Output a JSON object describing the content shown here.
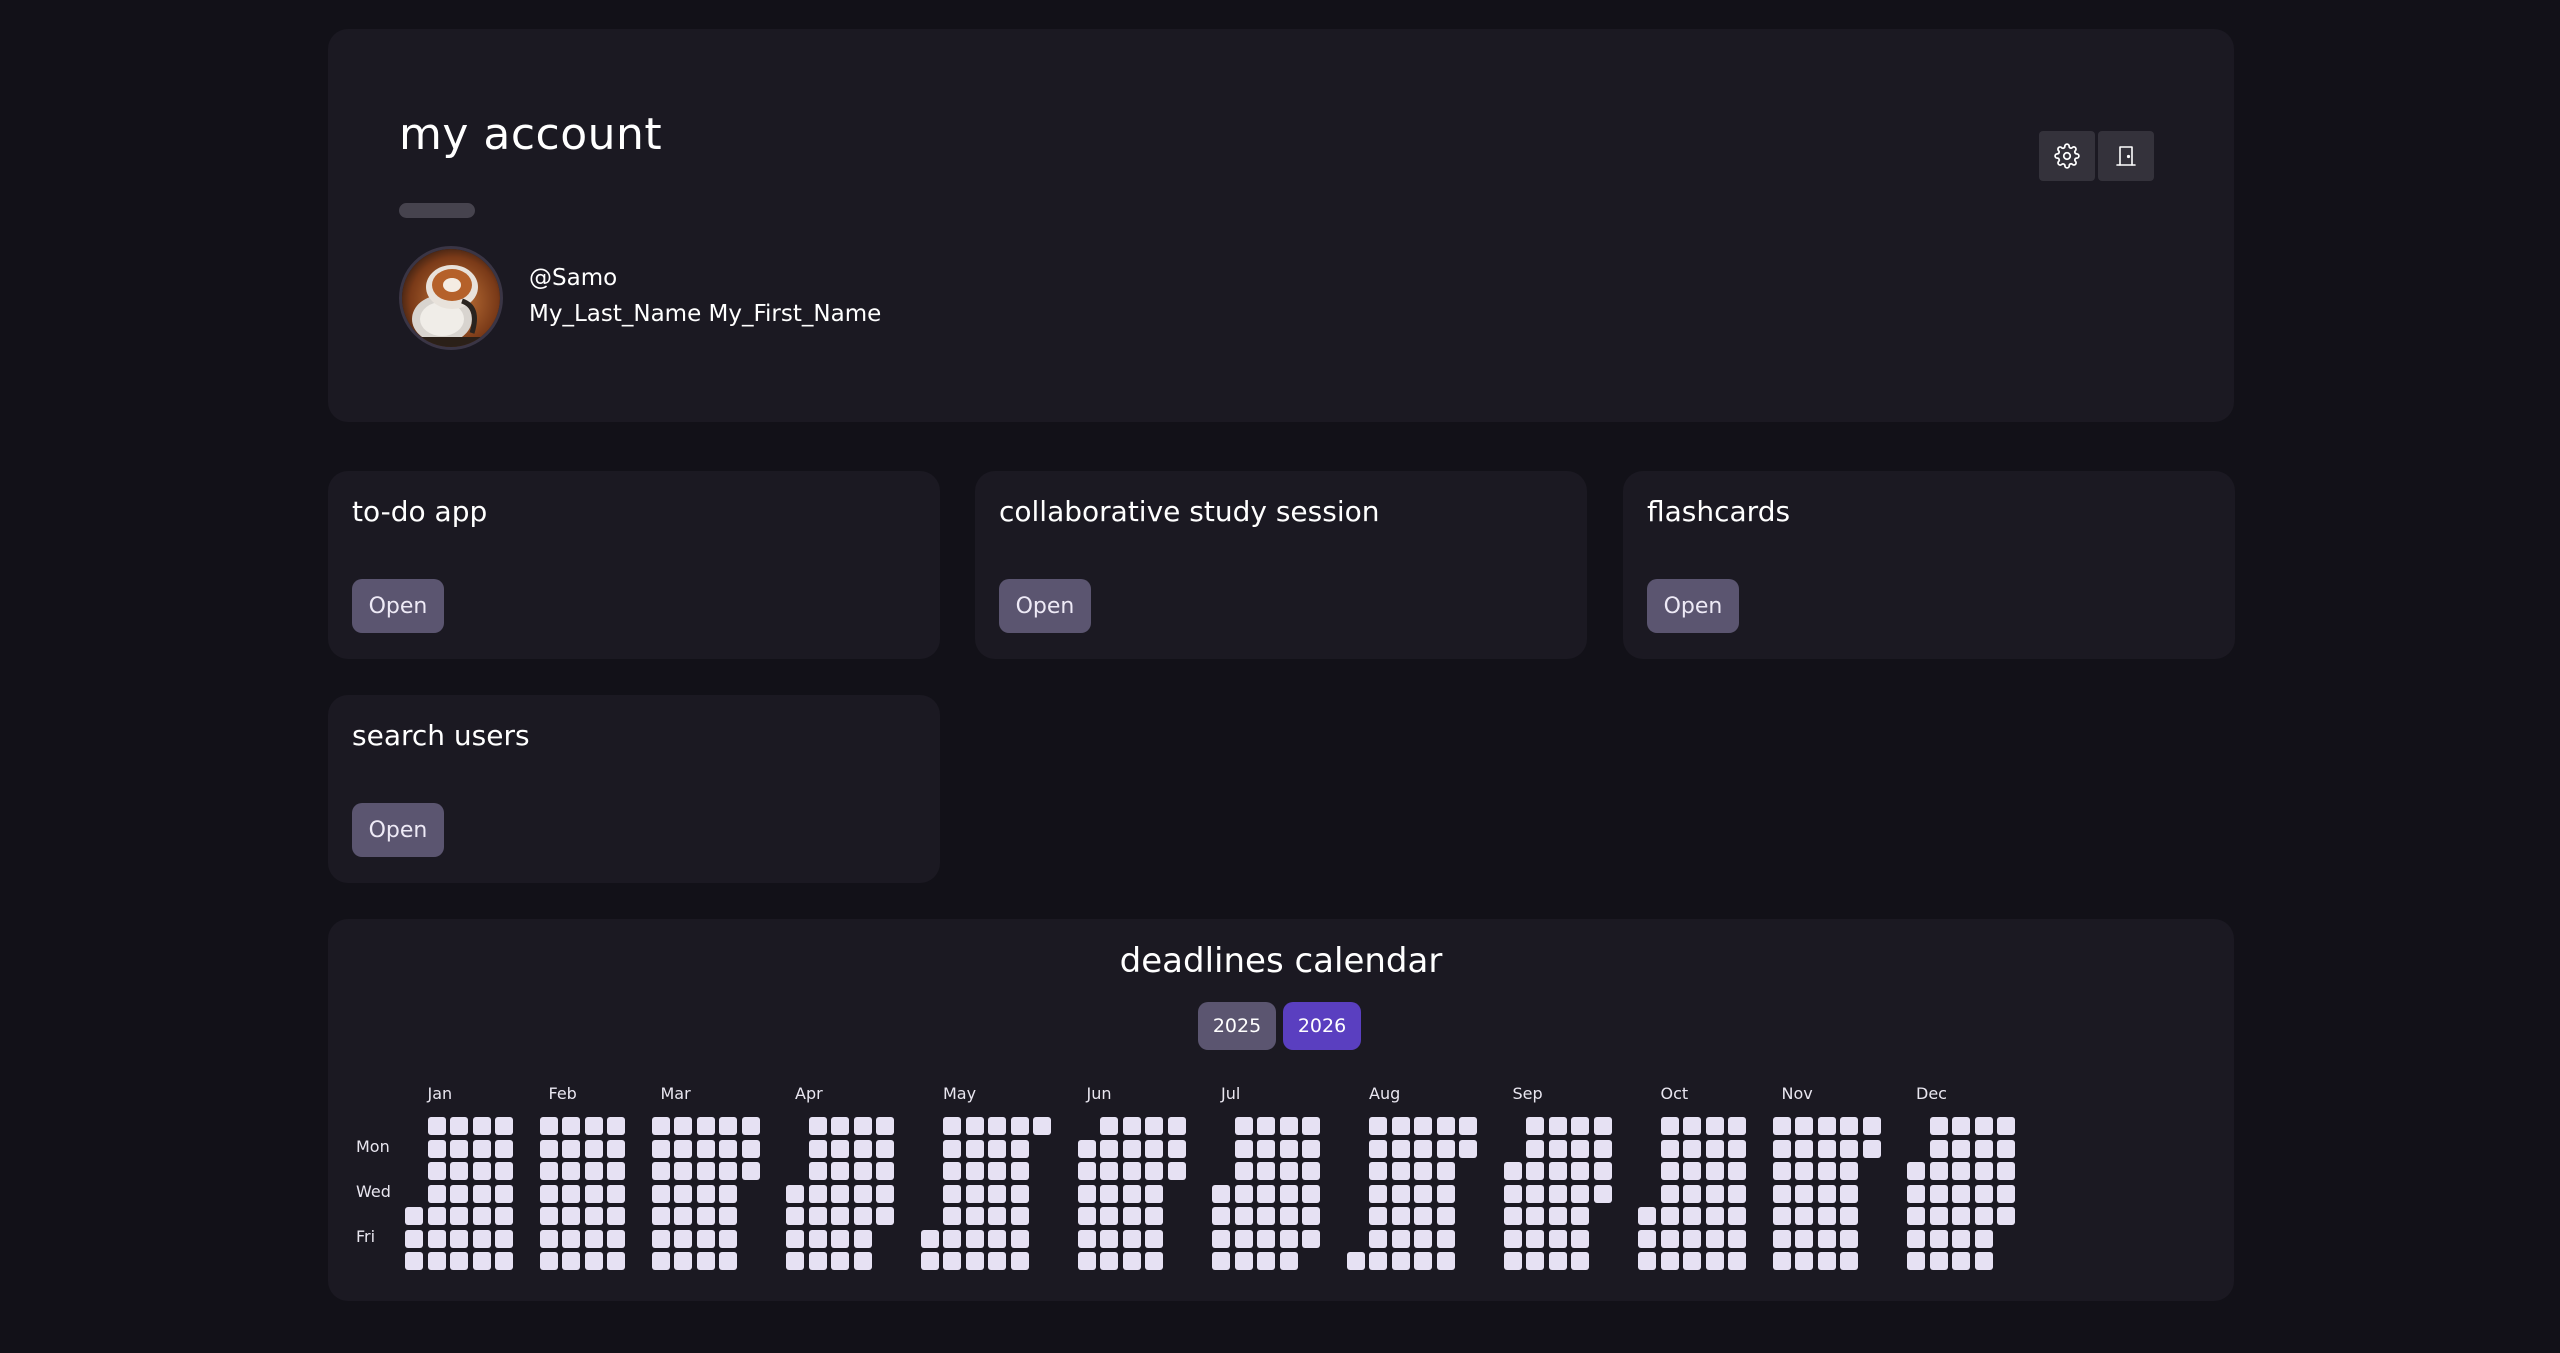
{
  "account": {
    "title": "my account",
    "handle": "@Samo",
    "full_name": "My_Last_Name My_First_Name",
    "settings_icon": "gear-icon",
    "logout_icon": "door-icon"
  },
  "apps": [
    {
      "title": "to-do app",
      "button": "Open"
    },
    {
      "title": "collaborative study session",
      "button": "Open"
    },
    {
      "title": "flashcards",
      "button": "Open"
    },
    {
      "title": "search users",
      "button": "Open"
    }
  ],
  "calendar": {
    "title": "deadlines calendar",
    "years": [
      "2025",
      "2026"
    ],
    "selected_year": "2026",
    "months": [
      "Jan",
      "Feb",
      "Mar",
      "Apr",
      "May",
      "Jun",
      "Jul",
      "Aug",
      "Sep",
      "Oct",
      "Nov",
      "Dec"
    ],
    "day_labels": [
      "Mon",
      "Wed",
      "Fri"
    ]
  },
  "colors": {
    "background": "#121118",
    "panel": "#1b1922",
    "button": "#5b5570",
    "accent": "#5a3fc0",
    "cell": "#e6e1f3"
  }
}
